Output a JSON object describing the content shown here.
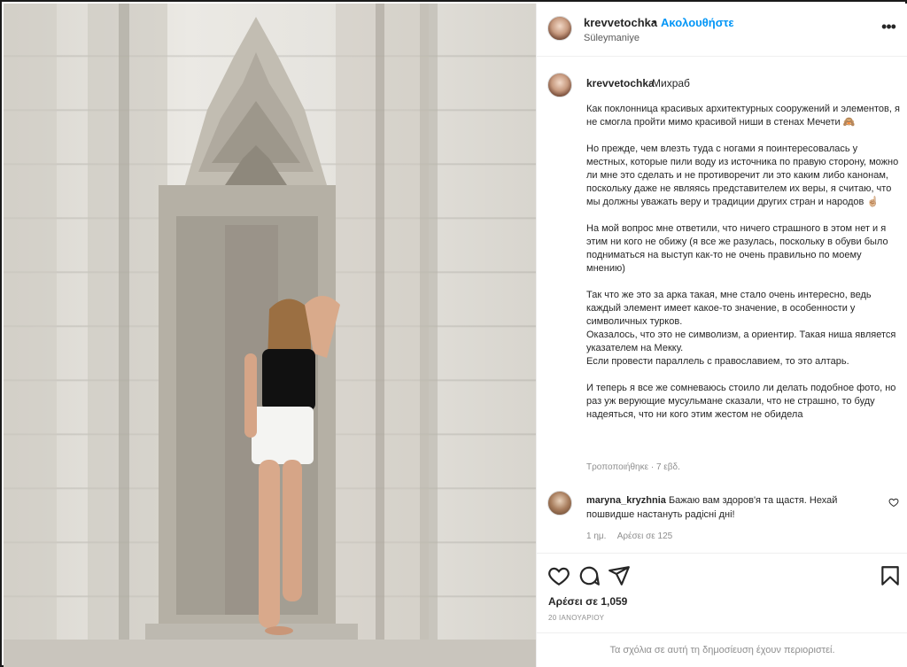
{
  "header": {
    "username": "krevvetochka",
    "separator": "•",
    "follow_label": "Ακολουθήστε",
    "location": "Süleymaniye",
    "more_label": "•••"
  },
  "caption": {
    "username": "krevvetochka",
    "title": "Михраб",
    "body": "Как поклонница красивых архитектурных сооружений и элементов, я не смогла пройти мимо красивой ниши в стенах Мечети 🙈\n\nНо прежде, чем влезть туда с ногами я поинтересовалась у местных, которые пили воду из источника по правую сторону, можно ли мне это сделать и не противоречит ли это каким либо канонам, поскольку даже не являясь представителем их веры, я считаю, что мы должны уважать веру и традиции других стран и народов ☝🏼\n\nНа мой вопрос мне ответили, что ничего страшного в этом нет и я этим ни кого не обижу (я все же разулась, поскольку в обуви было подниматься на выступ как-то не очень правильно по моему мнению)\n\nТак что же это за арка такая, мне стало очень интересно, ведь каждый элемент имеет какое-то значение, в особенности у символичных турков.\nОказалось, что это не символизм, а ориентир. Такая ниша является указателем на Мекку.\nЕсли провести параллель с православием, то это алтарь.\n\nИ теперь я все же сомневаюсь стоило ли делать подобное фото, но раз уж верующие мусульмане сказали, что не страшно, то буду надеяться, что ни кого этим жестом не обидела",
    "meta": "Τροποποιήθηκε · 7 εβδ."
  },
  "comment": {
    "username": "maryna_kryzhnia",
    "text": "Бажаю вам здоров'я та щастя. Нехай пошвидше настануть радісні дні!",
    "time": "1 ημ.",
    "likes": "Αρέσει σε 125"
  },
  "actions": {
    "icons": [
      "heart-icon",
      "comment-icon",
      "share-icon",
      "bookmark-icon"
    ],
    "likes": "Αρέσει σε 1,059",
    "date": "20 ΙΑΝΟΥΑΡΙΟΥ"
  },
  "footer": {
    "restricted_text": "Τα σχόλια σε αυτή τη δημοσίευση έχουν περιοριστεί."
  },
  "colors": {
    "accent": "#0095f6",
    "muted": "#8e8e8e",
    "text": "#262626"
  }
}
